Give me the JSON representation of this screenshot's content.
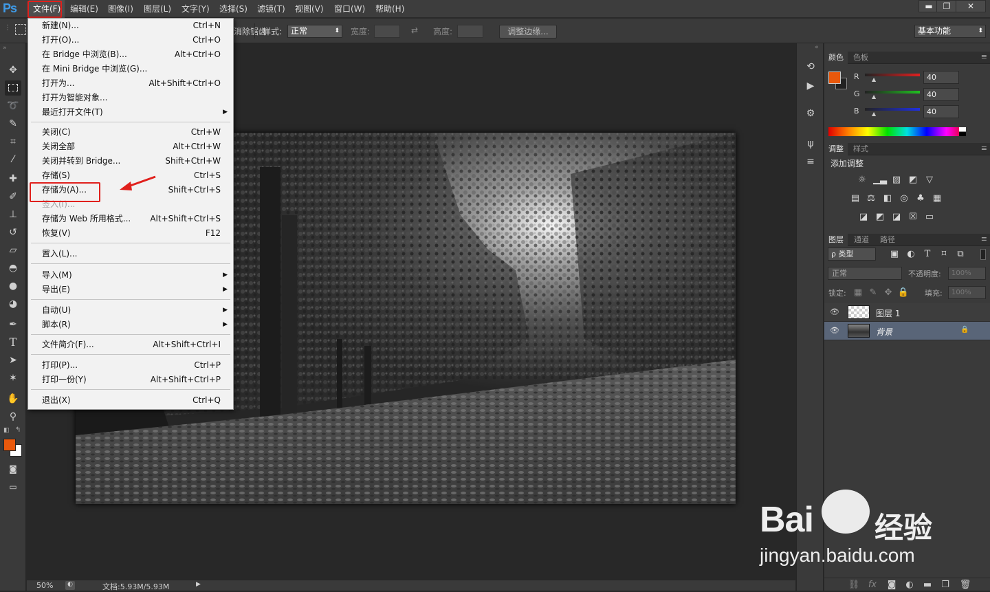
{
  "app": {
    "logo": "Ps"
  },
  "menubar": {
    "items": [
      "文件(F)",
      "编辑(E)",
      "图像(I)",
      "图层(L)",
      "文字(Y)",
      "选择(S)",
      "滤镜(T)",
      "视图(V)",
      "窗口(W)",
      "帮助(H)"
    ],
    "window_controls": {
      "minimize": "▬",
      "restore": "❐",
      "close": "✕"
    }
  },
  "options": {
    "feather_tail": "消除锯齿",
    "style_label": "样式:",
    "style_value": "正常",
    "width_label": "宽度:",
    "height_label": "高度:",
    "refine_edge": "调整边缘...",
    "workspace": "基本功能"
  },
  "file_menu": [
    {
      "label": "新建(N)...",
      "shortcut": "Ctrl+N"
    },
    {
      "label": "打开(O)...",
      "shortcut": "Ctrl+O"
    },
    {
      "label": "在 Bridge 中浏览(B)...",
      "shortcut": "Alt+Ctrl+O"
    },
    {
      "label": "在 Mini Bridge 中浏览(G)...",
      "shortcut": ""
    },
    {
      "label": "打开为...",
      "shortcut": "Alt+Shift+Ctrl+O"
    },
    {
      "label": "打开为智能对象...",
      "shortcut": ""
    },
    {
      "label": "最近打开文件(T)",
      "shortcut": ""
    },
    {
      "label": "关闭(C)",
      "shortcut": "Ctrl+W"
    },
    {
      "label": "关闭全部",
      "shortcut": "Alt+Ctrl+W"
    },
    {
      "label": "关闭并转到 Bridge...",
      "shortcut": "Shift+Ctrl+W"
    },
    {
      "label": "存储(S)",
      "shortcut": "Ctrl+S"
    },
    {
      "label": "存储为(A)...",
      "shortcut": "Shift+Ctrl+S"
    },
    {
      "label": "签入(I)...",
      "shortcut": ""
    },
    {
      "label": "存储为 Web 所用格式...",
      "shortcut": "Alt+Shift+Ctrl+S"
    },
    {
      "label": "恢复(V)",
      "shortcut": "F12"
    },
    {
      "label": "置入(L)...",
      "shortcut": ""
    },
    {
      "label": "导入(M)",
      "shortcut": ""
    },
    {
      "label": "导出(E)",
      "shortcut": ""
    },
    {
      "label": "自动(U)",
      "shortcut": ""
    },
    {
      "label": "脚本(R)",
      "shortcut": ""
    },
    {
      "label": "文件简介(F)...",
      "shortcut": "Alt+Shift+Ctrl+I"
    },
    {
      "label": "打印(P)...",
      "shortcut": "Ctrl+P"
    },
    {
      "label": "打印一份(Y)",
      "shortcut": "Alt+Shift+Ctrl+P"
    },
    {
      "label": "退出(X)",
      "shortcut": "Ctrl+Q"
    }
  ],
  "status": {
    "zoom": "50%",
    "doc": "文档:5.93M/5.93M"
  },
  "color_panel": {
    "tabs": [
      "颜色",
      "色板"
    ],
    "r_label": "R",
    "g_label": "G",
    "b_label": "B",
    "r": "40",
    "g": "40",
    "b": "40",
    "foreground": "#e8580c"
  },
  "adjust_panel": {
    "tabs": [
      "调整",
      "样式"
    ],
    "title": "添加调整"
  },
  "layers_panel": {
    "tabs": [
      "图层",
      "通道",
      "路径"
    ],
    "kind": "ρ 类型",
    "blend": "正常",
    "opacity_label": "不透明度:",
    "opacity": "100%",
    "lock_label": "锁定:",
    "fill_label": "填充:",
    "fill": "100%",
    "layers": [
      {
        "name": "图层 1"
      },
      {
        "name": "背景"
      }
    ]
  },
  "watermark": {
    "brand": "Bai",
    "brand2": "经验",
    "url": "jingyan.baidu.com"
  }
}
